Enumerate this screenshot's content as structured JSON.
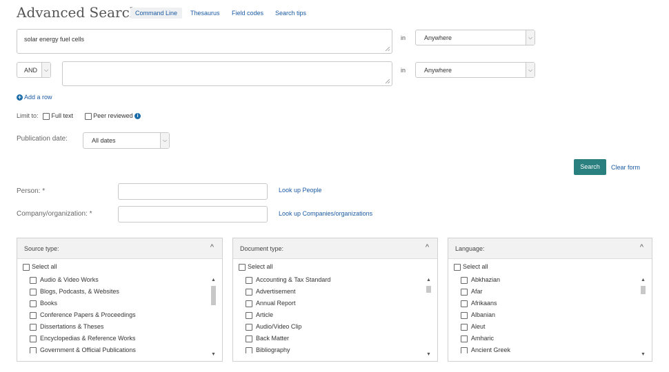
{
  "header": {
    "title": "Advanced Search",
    "tabs": [
      "Command Line",
      "Thesaurus",
      "Field codes",
      "Search tips"
    ]
  },
  "rows": [
    {
      "text": "solar energy fuel cells",
      "in_label": "in",
      "field": "Anywhere"
    },
    {
      "operator": "AND",
      "text": "",
      "in_label": "in",
      "field": "Anywhere"
    }
  ],
  "add_row": "Add a row",
  "limit": {
    "label": "Limit to:",
    "full_text": "Full text",
    "peer_reviewed": "Peer reviewed",
    "info_glyph": "i"
  },
  "pubdate": {
    "label": "Publication date:",
    "value": "All dates"
  },
  "actions": {
    "search": "Search",
    "clear": "Clear form"
  },
  "person": {
    "label": "Person:",
    "req": "*",
    "lookup": "Look up People"
  },
  "company": {
    "label": "Company/organization:",
    "req": "*",
    "lookup": "Look up Companies/organizations"
  },
  "panels": [
    {
      "title": "Source type:",
      "select_all": "Select all",
      "items": [
        "Audio & Video Works",
        "Blogs, Podcasts, & Websites",
        "Books",
        "Conference Papers & Proceedings",
        "Dissertations & Theses",
        "Encyclopedias & Reference Works",
        "Government & Official Publications"
      ]
    },
    {
      "title": "Document type:",
      "select_all": "Select all",
      "items": [
        "Accounting & Tax Standard",
        "Advertisement",
        "Annual Report",
        "Article",
        "Audio/Video Clip",
        "Back Matter",
        "Bibliography"
      ]
    },
    {
      "title": "Language:",
      "select_all": "Select all",
      "items": [
        "Abkhazian",
        "Afar",
        "Afrikaans",
        "Albanian",
        "Aleut",
        "Amharic",
        "Ancient Greek"
      ]
    }
  ],
  "icons": {
    "chevron_down": "⌵",
    "caret_up": "^",
    "scroll_up": "▲",
    "scroll_down": "▼",
    "plus": "+"
  },
  "colors": {
    "link": "#1a5aa3",
    "search_button": "#2a7f7f",
    "info": "#1a6ca8"
  }
}
